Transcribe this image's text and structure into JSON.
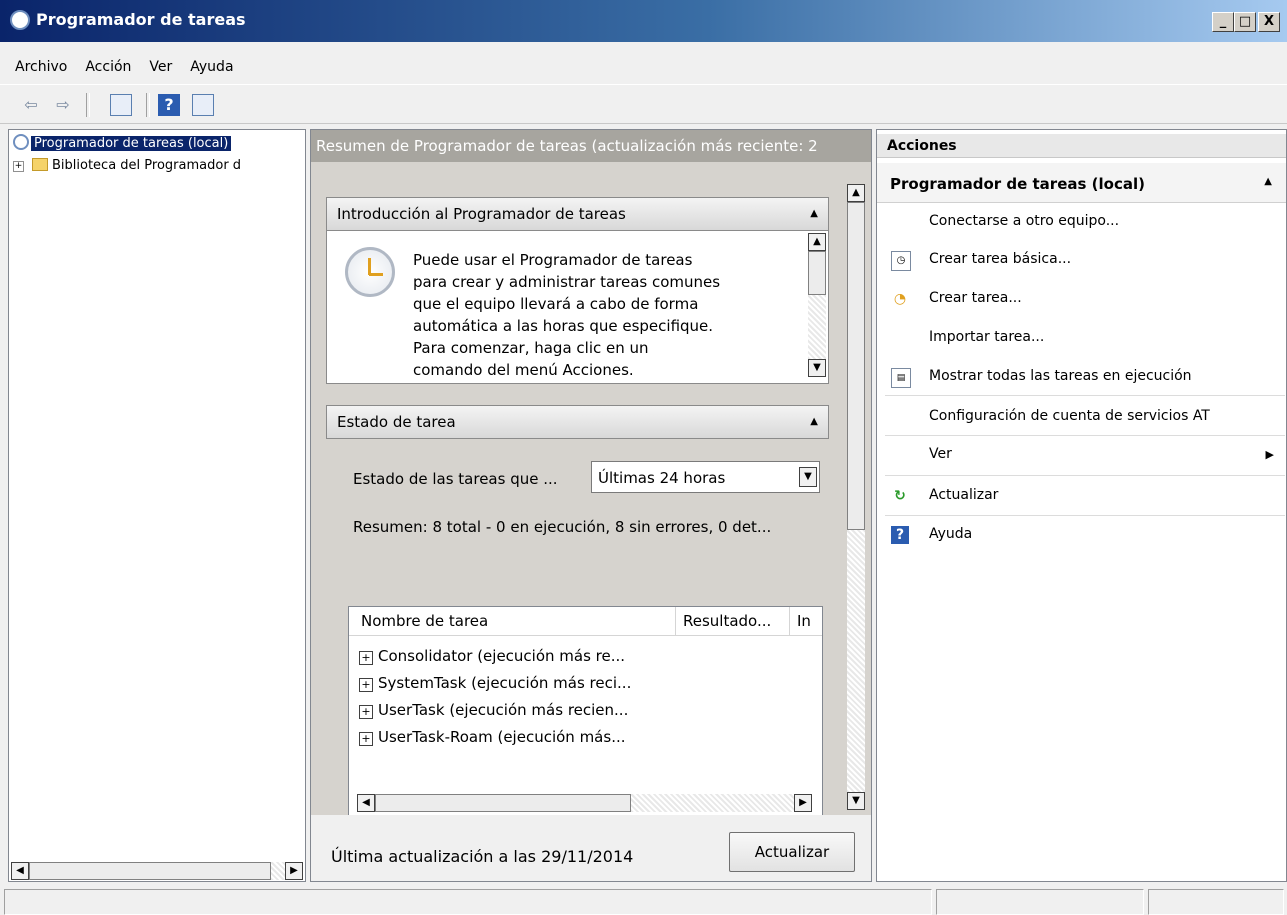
{
  "window": {
    "title": "Programador de tareas",
    "controls": [
      "_",
      "□",
      "X"
    ]
  },
  "menu": [
    "Archivo",
    "Acción",
    "Ver",
    "Ayuda"
  ],
  "tree": {
    "root": "Programador de tareas (local)",
    "child": "Biblioteca del Programador d"
  },
  "middle": {
    "header": "Resumen de Programador de tareas (actualización más reciente: 2",
    "intro": {
      "title": "Introducción al Programador de tareas",
      "lines": [
        "Puede usar el Programador de tareas",
        "para crear y administrar tareas comunes",
        "que el equipo llevará a cabo de forma",
        "automática a las horas que especifique.",
        "Para comenzar, haga clic en un",
        "comando del menú Acciones."
      ]
    },
    "status": {
      "title": "Estado de tarea",
      "filter_label": "Estado de las tareas que ...",
      "filter_value": "Últimas 24 horas",
      "summary": "Resumen: 8 total - 0 en ejecución, 8 sin errores, 0 det...",
      "columns": [
        "Nombre de tarea",
        "Resultado...",
        "In"
      ],
      "rows": [
        "Consolidator (ejecución más re...",
        "SystemTask (ejecución más reci...",
        "UserTask (ejecución más recien...",
        "UserTask-Roam (ejecución más..."
      ]
    },
    "last_update": "Última actualización a las 29/11/2014",
    "refresh_button": "Actualizar"
  },
  "actions": {
    "title": "Acciones",
    "section": "Programador de tareas (local)",
    "items": [
      "Conectarse a otro equipo...",
      "Crear tarea básica...",
      "Crear tarea...",
      "Importar tarea...",
      "Mostrar todas las tareas en ejecución",
      "Configuración de cuenta de servicios AT",
      "Ver",
      "Actualizar",
      "Ayuda"
    ]
  },
  "colors": {
    "title_start": "#0a246a",
    "title_end": "#a6caf0",
    "selection": "#0a246a",
    "accent_icon": "#3a6ea5"
  }
}
